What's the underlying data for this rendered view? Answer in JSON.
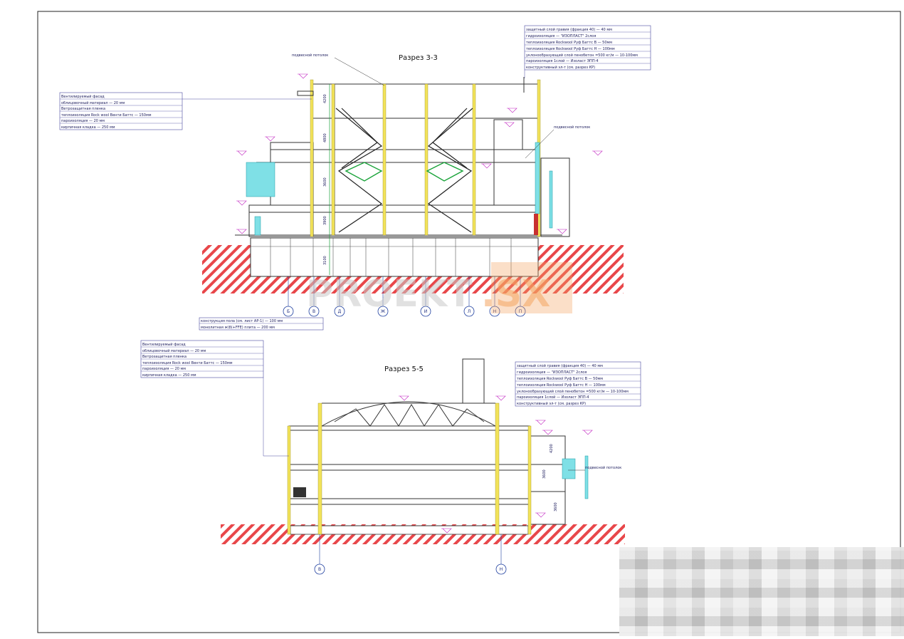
{
  "section_3_3": {
    "title": "Разрез 3-3",
    "facade_spec": [
      "Вентилируемый фасад",
      "облицовочный материал — 20 мм",
      "Ветрозащитная пленка",
      "теплоизоляция Rock wool Венти Баттс — 150мм",
      "пароизоляция — 20 мм",
      "кирпичная кладка — 250 мм"
    ],
    "roof_spec": [
      "защитный слой гравия (фракция 40) — 40 мм",
      "гидроизоляция — \"ИЗОПЛАСТ\" 2слоя",
      "теплоизоляция Rockwool Руф Баттс В — 50мм",
      "теплоизоляция Rockwool Руф Баттс Н — 100мм",
      "уклонообразующий слой пенобетон =500 кг/м — 10-100мм",
      "пароизоляция 1слой — Изоласт ЭПП-4",
      "конструктивный эл-т (см. разрез КР)"
    ],
    "floor_spec": [
      "конструкция пола (см. лист АР-1) — 100 мм",
      "монолитная ж\\б(+FFE) плита — 200 мм"
    ],
    "note_ceiling": "подвесной потолок",
    "note_ceiling_right": "подвесной потолок",
    "axes": [
      "Б",
      "В",
      "Д",
      "Ж",
      "И",
      "Л",
      "Н",
      "П"
    ],
    "dims": [
      "4200",
      "4800",
      "3600",
      "3900",
      "3100"
    ]
  },
  "section_5_5": {
    "title": "Разрез 5-5",
    "facade_spec": [
      "Вентилируемый фасад",
      "облицовочный материал — 20 мм",
      "Ветрозащитная пленка",
      "теплоизоляция Rock wool Венти Баттс — 150мм",
      "пароизоляция — 20 мм",
      "кирпичная кладка — 250 мм"
    ],
    "roof_spec": [
      "защитный слой гравия (фракция 40) — 40 мм",
      "гидроизоляция — \"ИЗОПЛАСТ\" 2слоя",
      "теплоизоляция Rockwool Руф Баттс В — 50мм",
      "теплоизоляция Rockwool Руф Баттс Н — 100мм",
      "уклонообразующий слой пенобетон =500 кг/м — 10-100мм",
      "пароизоляция 1слой — Изоласт ЭПП-4",
      "конструктивный эл-т (см. разрез КР)"
    ],
    "note_ceiling": "подвесной потолок",
    "axes": [
      "В",
      "Н"
    ],
    "dims": [
      "4200",
      "3600",
      "3600"
    ]
  },
  "watermark": {
    "part1": "PROEKT",
    "part2": ".SX"
  }
}
